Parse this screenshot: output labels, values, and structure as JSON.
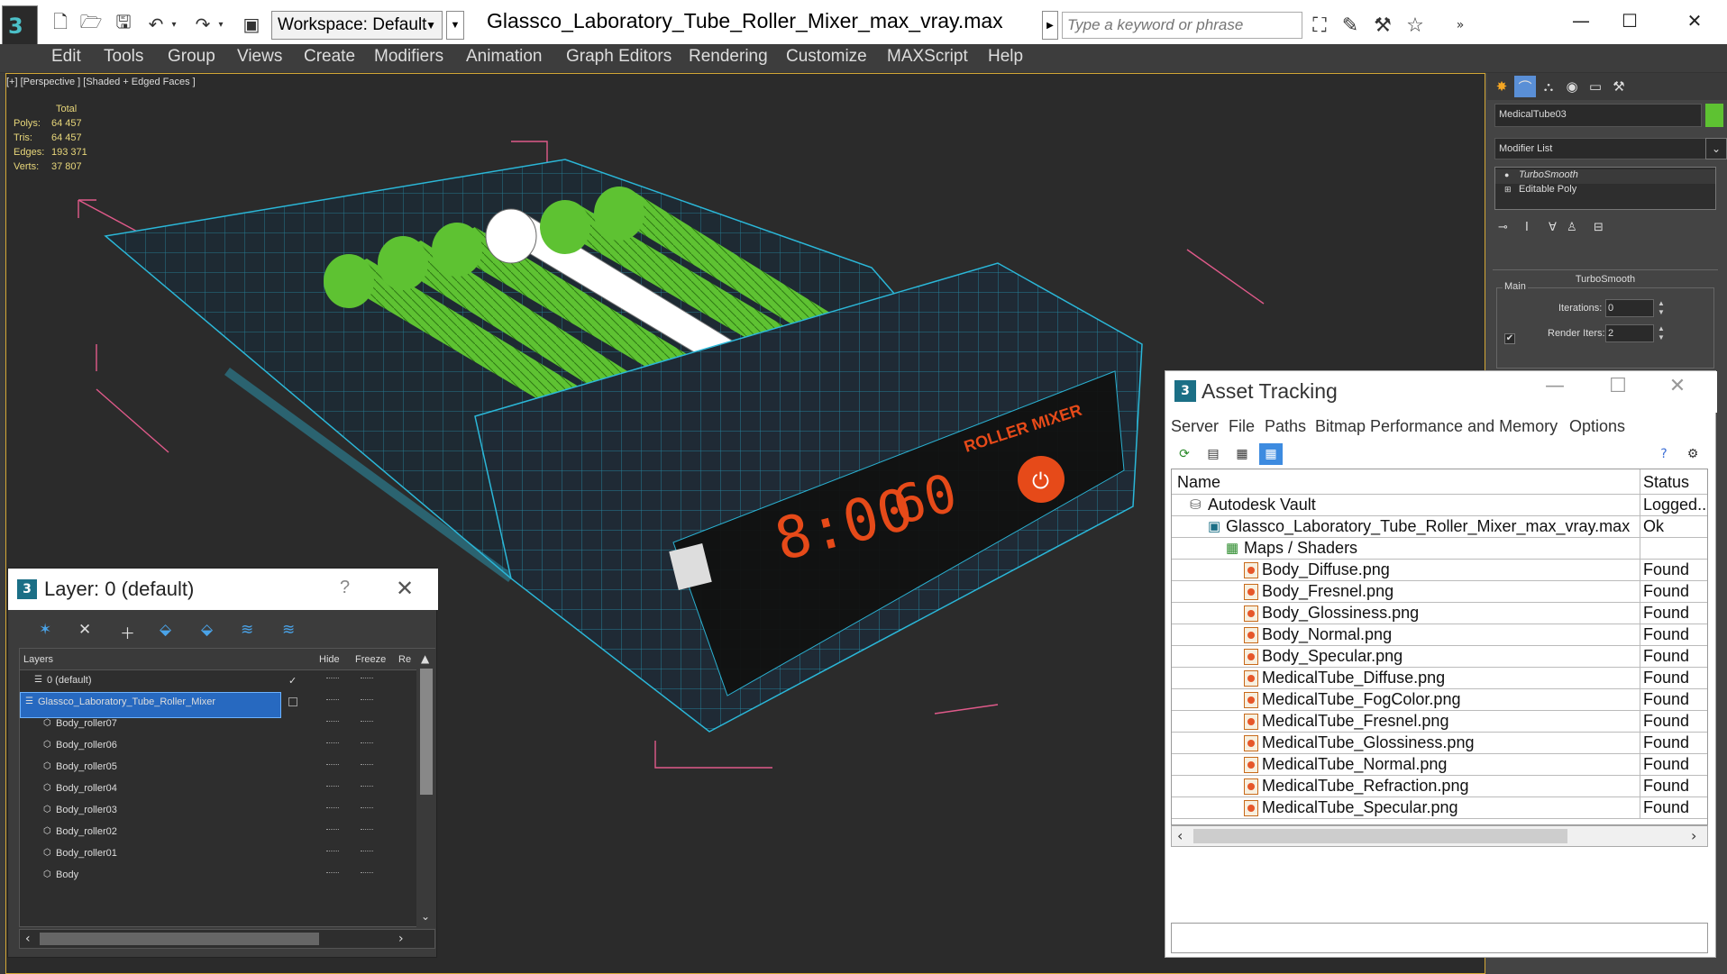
{
  "toolbar": {
    "workspace_label": "Workspace: Default",
    "file_title": "Glassco_Laboratory_Tube_Roller_Mixer_max_vray.max",
    "search_placeholder": "Type a keyword or phrase"
  },
  "menu": [
    "Edit",
    "Tools",
    "Group",
    "Views",
    "Create",
    "Modifiers",
    "Animation",
    "Graph Editors",
    "Rendering",
    "Customize",
    "MAXScript",
    "Help"
  ],
  "viewport": {
    "label": "[+] [Perspective ] [Shaded + Edged Faces ]",
    "stats": {
      "header": "Total",
      "polys_label": "Polys:",
      "polys": "64 457",
      "tris_label": "Tris:",
      "tris": "64 457",
      "edges_label": "Edges:",
      "edges": "193 371",
      "verts_label": "Verts:",
      "verts": "37 807"
    },
    "device_display_time": "8:00",
    "device_display_speed": "60",
    "device_brand_text": "ROLLER MIXER"
  },
  "command_panel": {
    "object_name": "MedicalTube03",
    "object_color": "#5ec232",
    "modifier_list": "Modifier List",
    "stack": [
      "TurboSmooth",
      "Editable Poly"
    ],
    "rollout_title": "TurboSmooth",
    "group_main": "Main",
    "iterations_label": "Iterations:",
    "iterations_value": "0",
    "render_iters_label": "Render Iters:",
    "render_iters_value": "2"
  },
  "layer_dialog": {
    "title": "Layer: 0 (default)",
    "help": "?",
    "columns": {
      "layers": "Layers",
      "hide": "Hide",
      "freeze": "Freeze",
      "render": "Re"
    },
    "rows": [
      {
        "name": "0 (default)",
        "indent": 1,
        "active": true
      },
      {
        "name": "Glassco_Laboratory_Tube_Roller_Mixer",
        "indent": 0,
        "selected": true
      },
      {
        "name": "Body_roller07",
        "indent": 2
      },
      {
        "name": "Body_roller06",
        "indent": 2
      },
      {
        "name": "Body_roller05",
        "indent": 2
      },
      {
        "name": "Body_roller04",
        "indent": 2
      },
      {
        "name": "Body_roller03",
        "indent": 2
      },
      {
        "name": "Body_roller02",
        "indent": 2
      },
      {
        "name": "Body_roller01",
        "indent": 2
      },
      {
        "name": "Body",
        "indent": 2
      }
    ]
  },
  "asset_dialog": {
    "title": "Asset Tracking",
    "menu": [
      "Server",
      "File",
      "Paths",
      "Bitmap Performance and Memory",
      "Options"
    ],
    "columns": {
      "name": "Name",
      "status": "Status"
    },
    "rows": [
      {
        "name": "Autodesk Vault",
        "status": "Logged..",
        "indent": 0,
        "icon": "vault"
      },
      {
        "name": "Glassco_Laboratory_Tube_Roller_Mixer_max_vray.max",
        "status": "Ok",
        "indent": 1,
        "icon": "max"
      },
      {
        "name": "Maps / Shaders",
        "status": "",
        "indent": 2,
        "icon": "folder"
      },
      {
        "name": "Body_Diffuse.png",
        "status": "Found",
        "indent": 3,
        "icon": "image"
      },
      {
        "name": "Body_Fresnel.png",
        "status": "Found",
        "indent": 3,
        "icon": "image"
      },
      {
        "name": "Body_Glossiness.png",
        "status": "Found",
        "indent": 3,
        "icon": "image"
      },
      {
        "name": "Body_Normal.png",
        "status": "Found",
        "indent": 3,
        "icon": "image"
      },
      {
        "name": "Body_Specular.png",
        "status": "Found",
        "indent": 3,
        "icon": "image"
      },
      {
        "name": "MedicalTube_Diffuse.png",
        "status": "Found",
        "indent": 3,
        "icon": "image"
      },
      {
        "name": "MedicalTube_FogColor.png",
        "status": "Found",
        "indent": 3,
        "icon": "image"
      },
      {
        "name": "MedicalTube_Fresnel.png",
        "status": "Found",
        "indent": 3,
        "icon": "image"
      },
      {
        "name": "MedicalTube_Glossiness.png",
        "status": "Found",
        "indent": 3,
        "icon": "image"
      },
      {
        "name": "MedicalTube_Normal.png",
        "status": "Found",
        "indent": 3,
        "icon": "image"
      },
      {
        "name": "MedicalTube_Refraction.png",
        "status": "Found",
        "indent": 3,
        "icon": "image"
      },
      {
        "name": "MedicalTube_Specular.png",
        "status": "Found",
        "indent": 3,
        "icon": "image"
      }
    ]
  }
}
